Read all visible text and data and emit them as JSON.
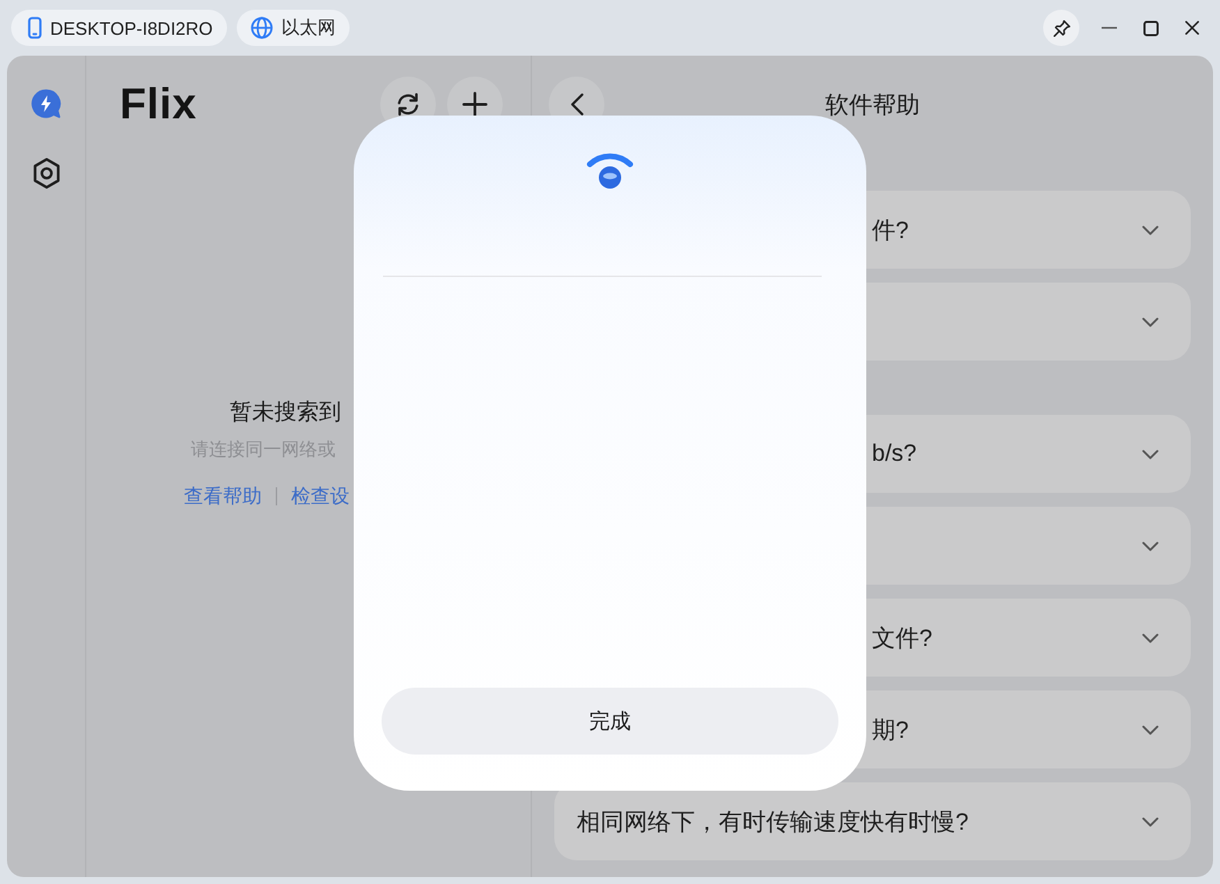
{
  "title_bar": {
    "chips": [
      {
        "kind": "device",
        "label": "DESKTOP-I8DI2RO"
      },
      {
        "kind": "network",
        "label": "以太网"
      }
    ],
    "pin": {
      "on": true
    }
  },
  "sidebar": {
    "items": [
      {
        "kind": "flash",
        "selected": true
      },
      {
        "kind": "settings",
        "selected": false
      }
    ]
  },
  "devices_panel": {
    "logo": "Flix",
    "empty_state": {
      "title": "暂未搜索到",
      "hint": "请连接同一网络或",
      "links": [
        "查看帮助",
        "检查设"
      ]
    }
  },
  "help_panel": {
    "title": "软件帮助",
    "sections": [
      {
        "questions": [
          {
            "text": "件?",
            "expanded": false
          },
          {
            "expanded": false
          }
        ]
      },
      {
        "questions": [
          {
            "text": "b/s?",
            "expanded": false
          },
          {
            "expanded": false
          },
          {
            "text": "文件?",
            "expanded": false
          },
          {
            "text": "期?",
            "expanded": false
          },
          {
            "text": "相同网络下，有时传输速度快有时慢?",
            "expanded": false
          }
        ]
      }
    ]
  },
  "dialog": {
    "button": "完成"
  }
}
